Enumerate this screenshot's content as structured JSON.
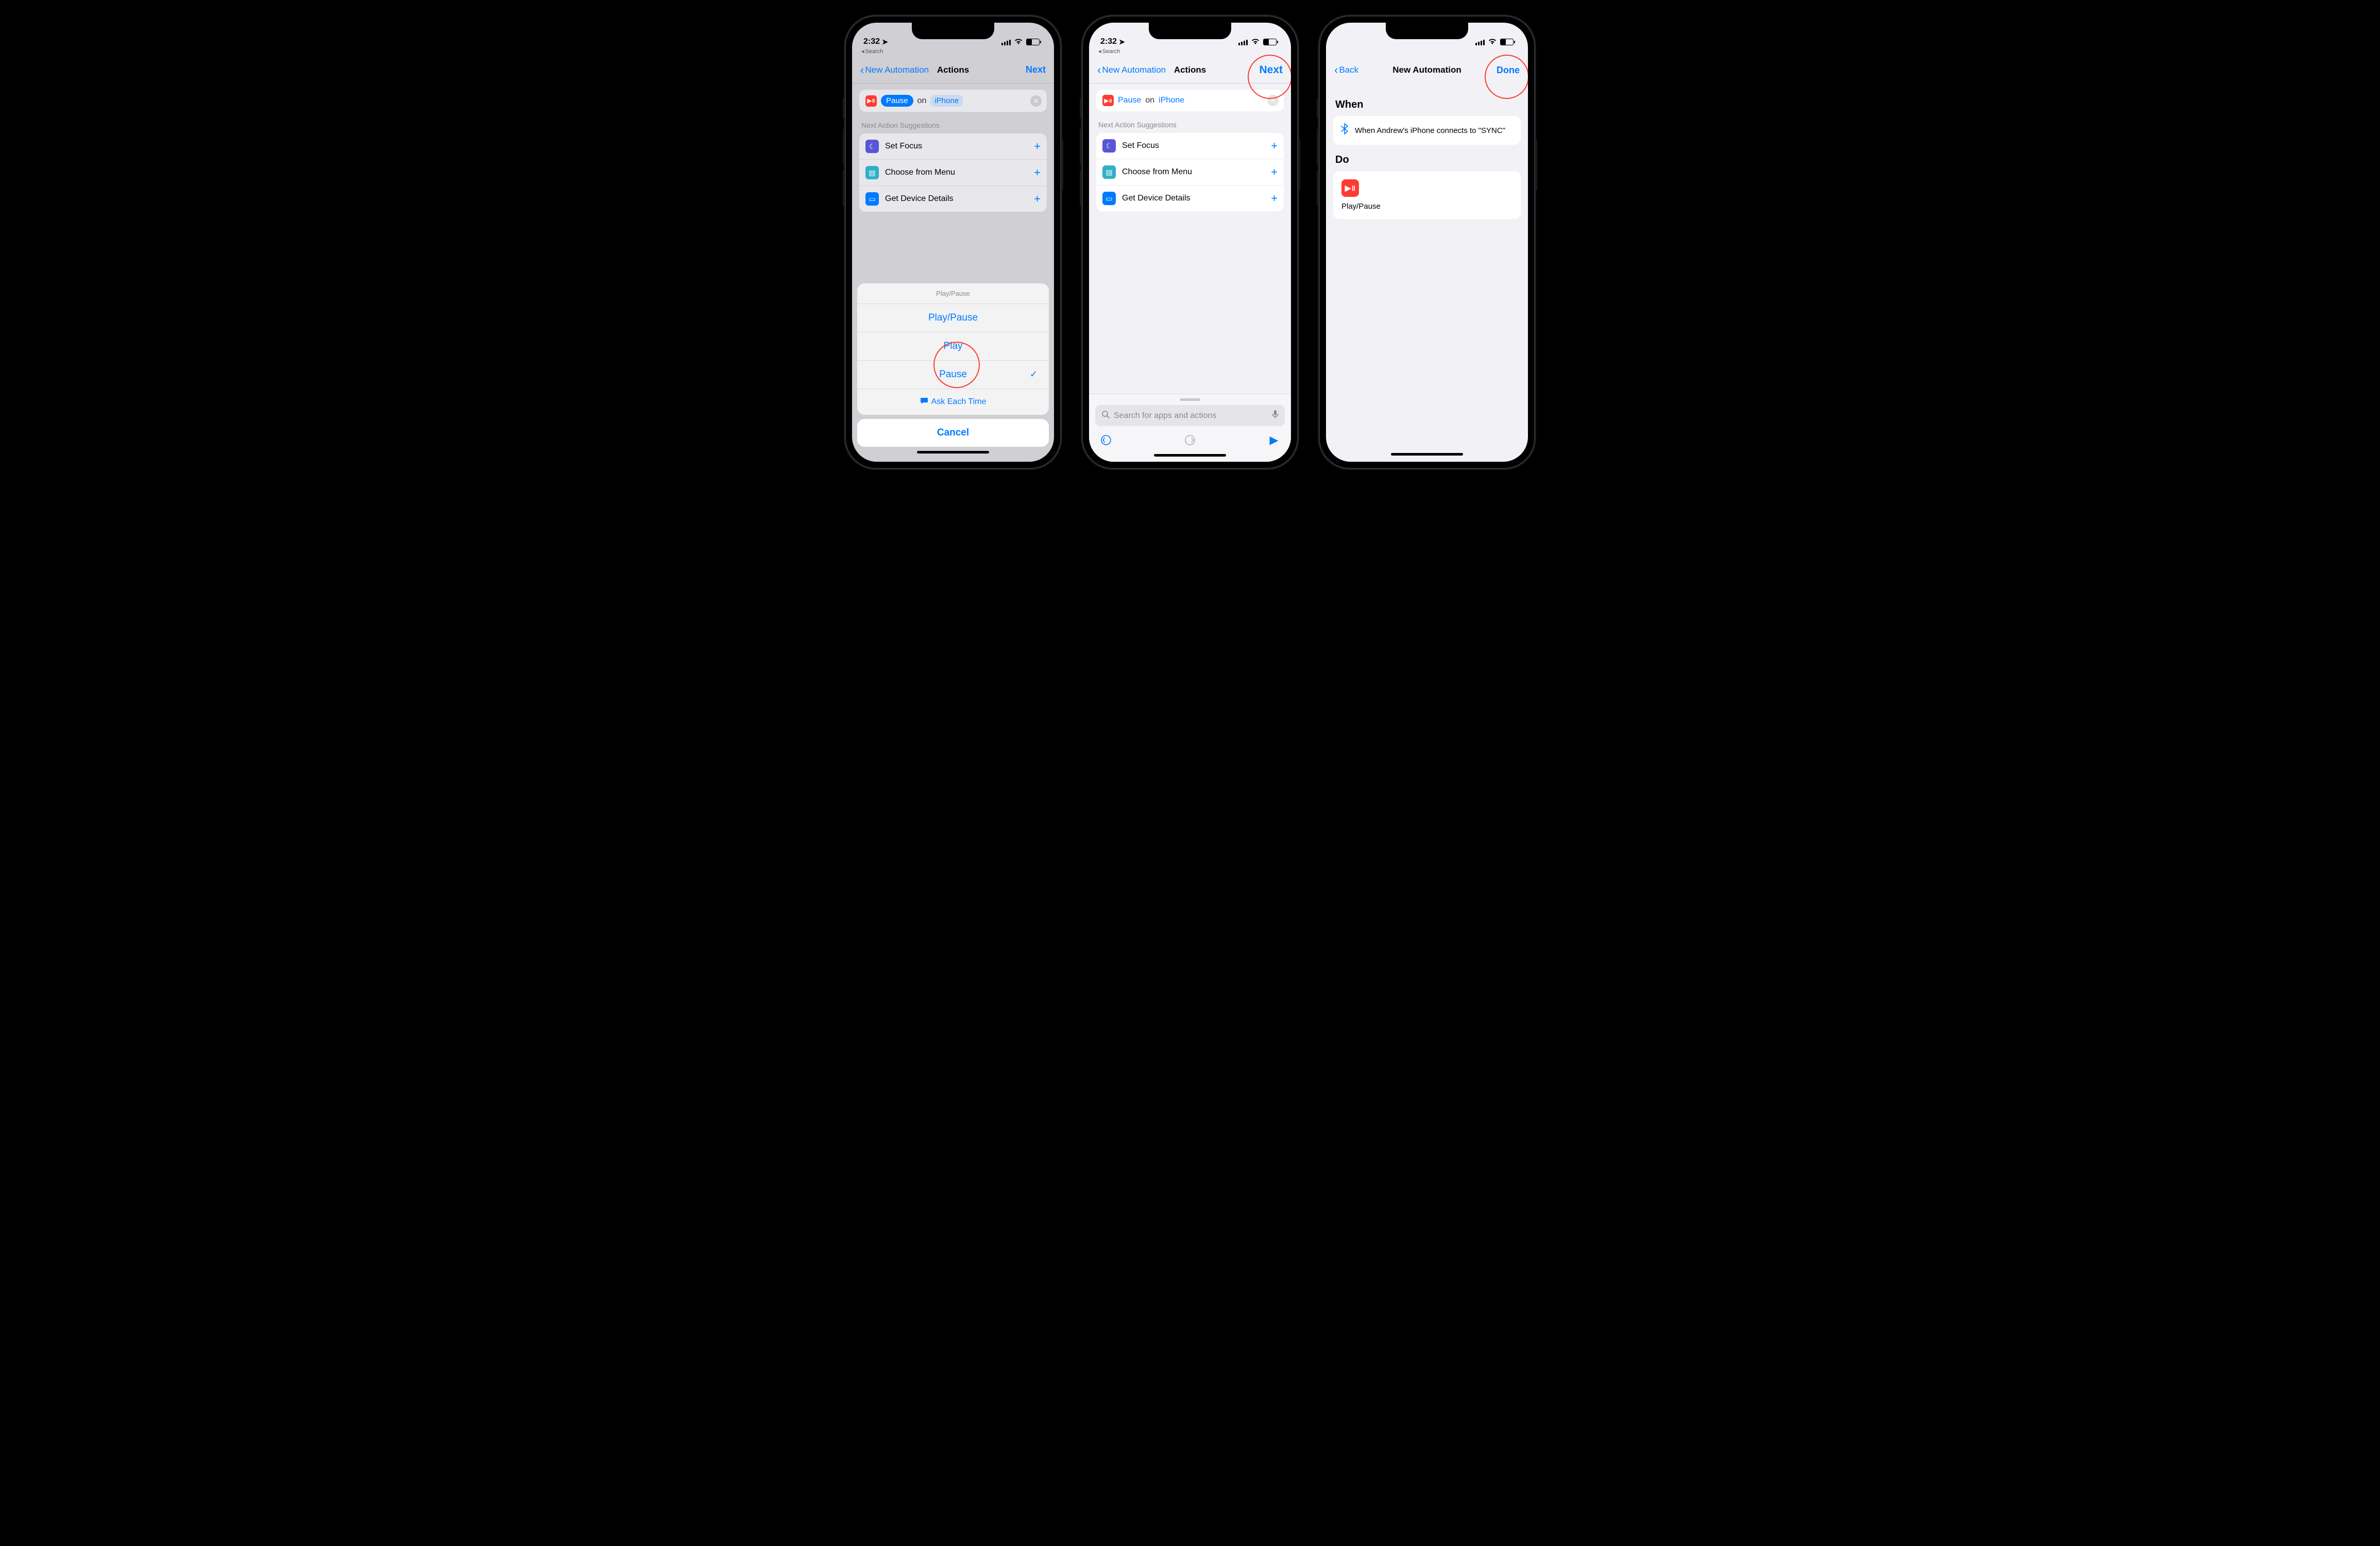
{
  "status": {
    "time": "2:32",
    "breadcrumb": "Search"
  },
  "screen1": {
    "back": "New Automation",
    "title": "Actions",
    "next": "Next",
    "action": {
      "pill": "Pause",
      "on": "on",
      "device": "iPhone"
    },
    "suggestions_label": "Next Action Suggestions",
    "suggestions": [
      {
        "label": "Set Focus",
        "iconClass": "icon-purple",
        "glyph": "☾"
      },
      {
        "label": "Choose from Menu",
        "iconClass": "icon-teal",
        "glyph": "▤"
      },
      {
        "label": "Get Device Details",
        "iconClass": "icon-blue",
        "glyph": "▭"
      }
    ],
    "sheet": {
      "header": "Play/Pause",
      "options": [
        "Play/Pause",
        "Play",
        "Pause"
      ],
      "selected": "Pause",
      "ask": "Ask Each Time",
      "cancel": "Cancel"
    }
  },
  "screen2": {
    "back": "New Automation",
    "title": "Actions",
    "next": "Next",
    "action": {
      "pill": "Pause",
      "on": "on",
      "device": "iPhone"
    },
    "suggestions_label": "Next Action Suggestions",
    "suggestions": [
      {
        "label": "Set Focus",
        "iconClass": "icon-purple",
        "glyph": "☾"
      },
      {
        "label": "Choose from Menu",
        "iconClass": "icon-teal",
        "glyph": "▤"
      },
      {
        "label": "Get Device Details",
        "iconClass": "icon-blue",
        "glyph": "▭"
      }
    ],
    "search_placeholder": "Search for apps and actions"
  },
  "screen3": {
    "back": "Back",
    "title": "New Automation",
    "done": "Done",
    "when_heading": "When",
    "when_text": "When Andrew's iPhone connects to \"SYNC\"",
    "do_heading": "Do",
    "do_text": "Play/Pause"
  }
}
